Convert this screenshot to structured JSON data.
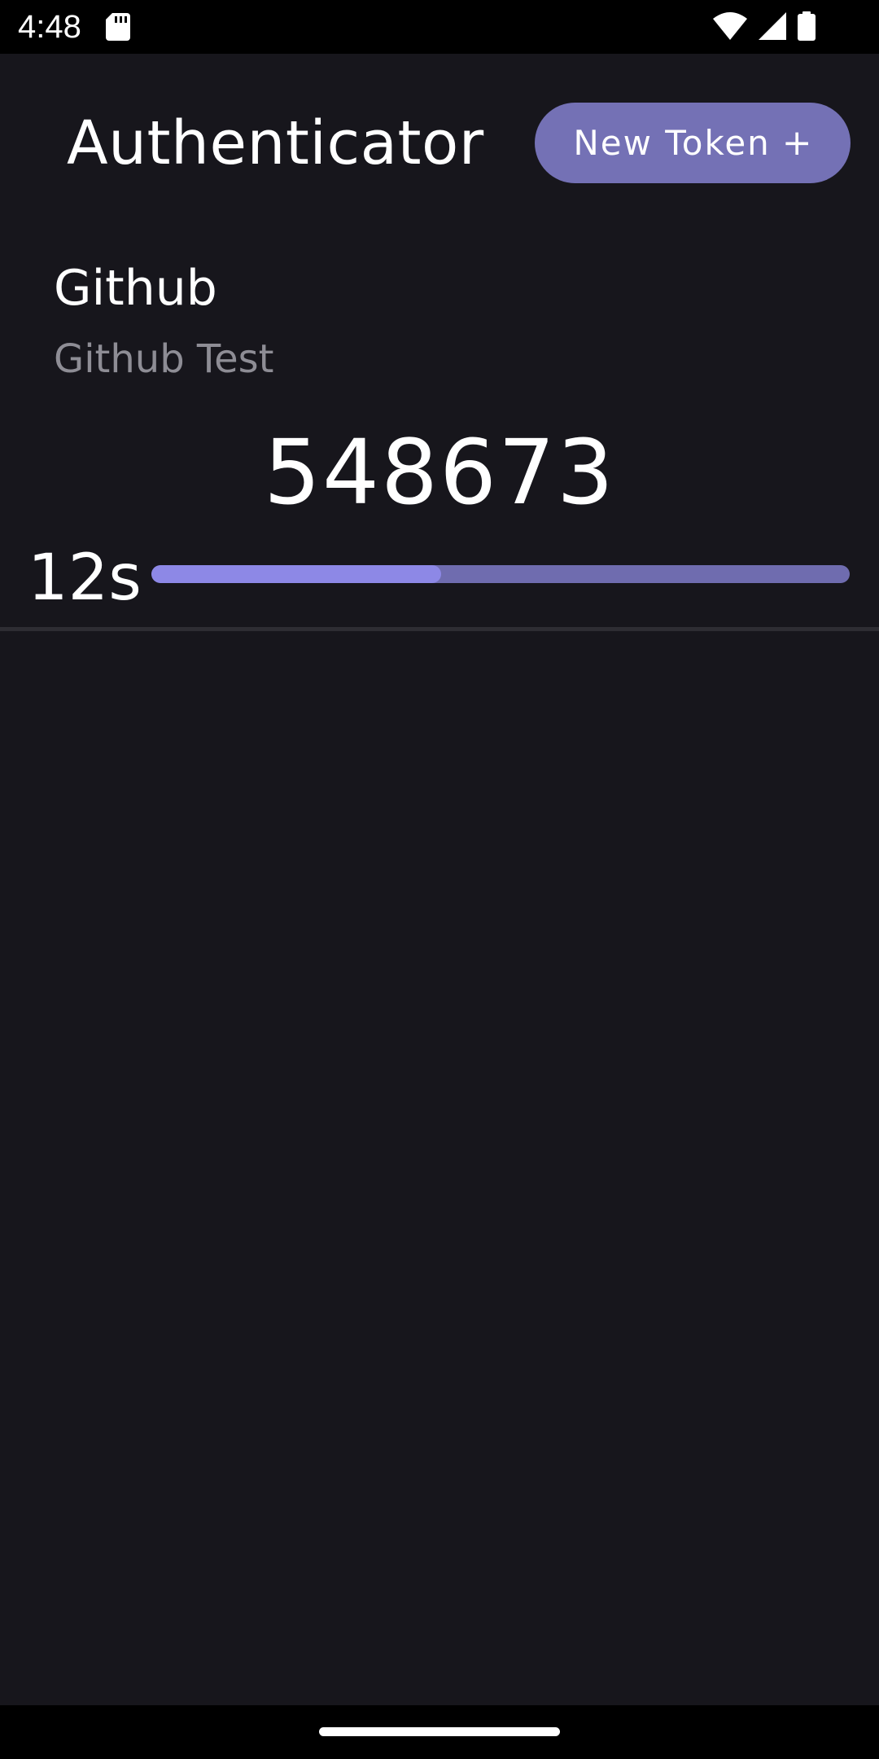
{
  "status_bar": {
    "time": "4:48",
    "icons": [
      "sd-card-icon",
      "wifi-icon",
      "cellular-signal-icon",
      "battery-icon"
    ]
  },
  "header": {
    "title": "Authenticator",
    "new_token_label": "New Token",
    "new_token_icon": "plus-icon",
    "new_token_icon_glyph": "+"
  },
  "tokens": [
    {
      "issuer": "Github",
      "account": "Github Test",
      "code": "548673",
      "countdown_label": "12s",
      "progress_fraction": 0.415
    }
  ],
  "colors": {
    "background": "#17161c",
    "accent": "#7471b5",
    "progress_fill": "#8d88e6",
    "secondary_text": "#8e8d95"
  }
}
